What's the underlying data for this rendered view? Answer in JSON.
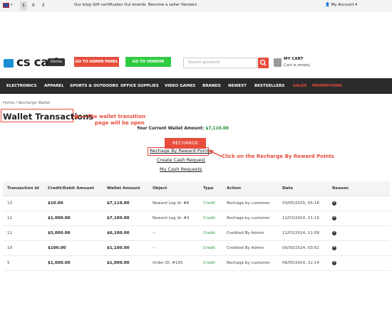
{
  "topbar": {
    "currencies": [
      "$",
      "€",
      "£"
    ],
    "links": [
      "Our blog",
      "Gift certificates",
      "Our brands",
      "Become a seller",
      "Vendors"
    ],
    "account": "My Account ▾"
  },
  "header": {
    "logo_text": "cs cart",
    "demo_badge": "Demo",
    "admin_button": "GO TO ADMIN PANEL",
    "vendor_button": "GO TO VENDOR PANEL",
    "search_placeholder": "Search products",
    "cart_title": "MY CART",
    "cart_status": "Cart is empty"
  },
  "nav": {
    "items": [
      "ELECTRONICS",
      "APPAREL",
      "SPORTS & OUTDOORS",
      "OFFICE SUPPLIES",
      "VIDEO GAMES",
      "BRANDS",
      "NEWEST",
      "BESTSELLERS",
      "SALES",
      "PROMOTIONS"
    ]
  },
  "breadcrumb": {
    "home": "Home",
    "separator": "/",
    "current": "Recharge Wallet"
  },
  "page": {
    "title": "Wallet Transactions",
    "annotation_title_line1": "The wallet transition",
    "annotation_title_line2": "page will be open",
    "amount_label": "Your Current Wallet Amount:",
    "amount_value": "$7,110.00",
    "recharge_button": "RECHARGE WALLET",
    "link_reward": "Rechage By Reward Points",
    "link_cash": "Create Cash Request",
    "link_my_cash": "My Cash Requests",
    "annotation_link": "Click on the Recharge By Reward Points"
  },
  "table": {
    "headers": [
      "Transaction Id",
      "Credit/Debit Amount",
      "Wallet Amount",
      "Object",
      "Type",
      "Action",
      "Date",
      "Reason"
    ],
    "rows": [
      {
        "id": "13",
        "amount": "$10.00",
        "wallet": "$7,110.00",
        "object": "Reward Log Id: #8",
        "type": "Credit",
        "action": "Rechage by customer",
        "date": "03/05/2025, 05:18"
      },
      {
        "id": "12",
        "amount": "$1,000.00",
        "wallet": "$7,100.00",
        "object": "Reward Log Id: #3",
        "type": "Credit",
        "action": "Rechage by customer",
        "date": "12/03/2024, 11:16"
      },
      {
        "id": "11",
        "amount": "$5,000.00",
        "wallet": "$6,100.00",
        "object": "--",
        "type": "Credit",
        "action": "Credited By Admin",
        "date": "12/03/2024, 11:09"
      },
      {
        "id": "10",
        "amount": "$100.00",
        "wallet": "$1,100.00",
        "object": "--",
        "type": "Credit",
        "action": "Credited By Admin",
        "date": "09/30/2024, 03:02"
      },
      {
        "id": "5",
        "amount": "$1,000.00",
        "wallet": "$1,000.00",
        "object": "Order ID: #105",
        "type": "Credit",
        "action": "Rechage by customer",
        "date": "06/05/2024, 22:14"
      }
    ]
  }
}
